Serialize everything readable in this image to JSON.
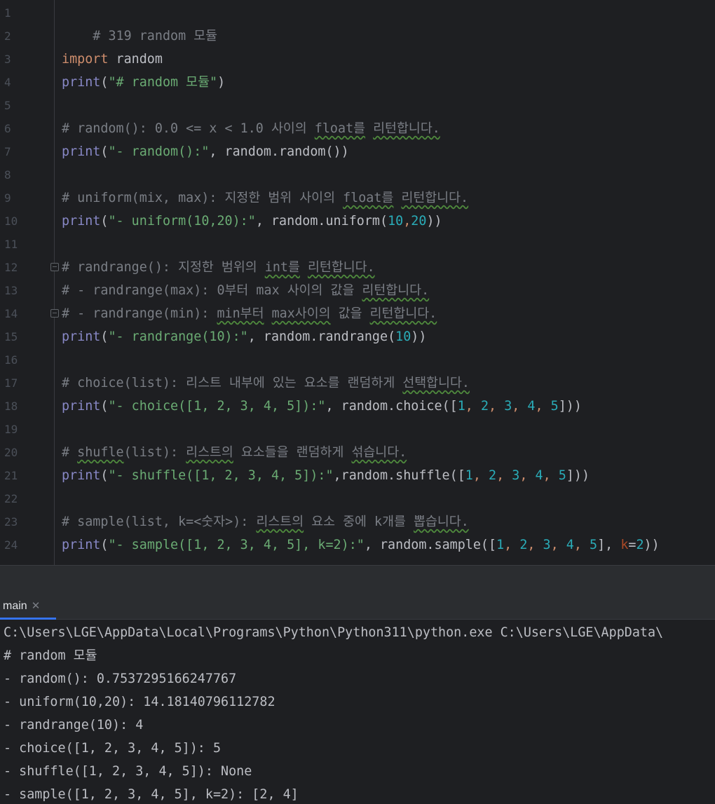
{
  "editor": {
    "line_numbers": [
      "1",
      "2",
      "3",
      "4",
      "5",
      "6",
      "7",
      "8",
      "9",
      "10",
      "11",
      "12",
      "13",
      "14",
      "15",
      "16",
      "17",
      "18",
      "19",
      "20",
      "21",
      "22",
      "23",
      "24"
    ],
    "code": {
      "l1": "# 319 random 모듈",
      "l3_kw": "import",
      "l3_rest": " random",
      "l4_print": "print",
      "l4_open": "(",
      "l4_str": "\"# random 모듈\"",
      "l4_close": ")",
      "l6": "# random(): 0.0 <= x < 1.0 사이의 ",
      "l6_w1": "float를",
      "l6_sp": " ",
      "l6_w2": "리턴합니다.",
      "l7_print": "print",
      "l7_open": "(",
      "l7_str": "\"- random():\"",
      "l7_rest": ", random.random())",
      "l9": "# uniform(mix, max): 지정한 범위 사이의 ",
      "l9_w1": "float를",
      "l9_sp": " ",
      "l9_w2": "리턴합니다.",
      "l10_print": "print",
      "l10_open": "(",
      "l10_str": "\"- uniform(10,20):\"",
      "l10_a": ", random.uniform(",
      "l10_n1": "10",
      "l10_c": ",",
      "l10_n2": "20",
      "l10_z": "))",
      "l12": "# randrange(): 지정한 범위의 ",
      "l12_w1": "int를",
      "l12_sp": " ",
      "l12_w2": "리턴합니다.",
      "l13": "# - randrange(max): 0부터 max 사이의 값을 ",
      "l13_w1": "리턴합니다.",
      "l14": "# - randrange(min): ",
      "l14_w1": "min부터",
      "l14_sp": " ",
      "l14_w2": "max사이의",
      "l14_mid": " 값을 ",
      "l14_w3": "리턴합니다.",
      "l15_print": "print",
      "l15_open": "(",
      "l15_str": "\"- randrange(10):\"",
      "l15_a": ", random.randrange(",
      "l15_n": "10",
      "l15_z": "))",
      "l17": "# choice(list): 리스트 내부에 있는 요소를 랜덤하게 ",
      "l17_w1": "선택합니다.",
      "l18_print": "print",
      "l18_open": "(",
      "l18_str": "\"- choice([1, 2, 3, 4, 5]):\"",
      "l18_a": ", random.choice([",
      "l18_n1": "1",
      "l18_n2": "2",
      "l18_n3": "3",
      "l18_n4": "4",
      "l18_n5": "5",
      "l18_z": "]))",
      "l20_a": "# ",
      "l20_w1": "shufle",
      "l20_b": "(list): ",
      "l20_w2": "리스트의",
      "l20_c": " 요소들을 랜덤하게 ",
      "l20_w3": "섞습니다.",
      "l21_print": "print",
      "l21_open": "(",
      "l21_str": "\"- shuffle([1, 2, 3, 4, 5]):\"",
      "l21_a": ",random.shuffle([",
      "l21_z": "]))",
      "l23_a": "# sample(list, k=<숫자>): ",
      "l23_w1": "리스트의",
      "l23_b": " 요소 중에 k개를 ",
      "l23_w2": "뽑습니다.",
      "l24_print": "print",
      "l24_open": "(",
      "l24_str": "\"- sample([1, 2, 3, 4, 5], k=2):\"",
      "l24_a": ", random.sample([",
      "l24_b": "], ",
      "l24_k": "k",
      "l24_eq": "=",
      "l24_n": "2",
      "l24_z": "))",
      "comma_sp": ", "
    }
  },
  "run_panel": {
    "tab_label": "main",
    "close_glyph": "✕",
    "output": [
      "C:\\Users\\LGE\\AppData\\Local\\Programs\\Python\\Python311\\python.exe C:\\Users\\LGE\\AppData\\",
      "# random 모듈",
      "- random(): 0.7537295166247767",
      "- uniform(10,20): 14.18140796112782",
      "- randrange(10): 4",
      "- choice([1, 2, 3, 4, 5]): 5",
      "- shuffle([1, 2, 3, 4, 5]): None",
      "- sample([1, 2, 3, 4, 5], k=2): [2, 4]"
    ]
  },
  "colors": {
    "background": "#1e1f22",
    "keyword": "#cf8e6d",
    "string": "#6aab73",
    "number": "#2aacb8",
    "comment": "#7a7e85",
    "builtin": "#8888c6",
    "tab_accent": "#3574f0"
  },
  "icons": {
    "fold_markers": "fold-icon",
    "tab_close": "close-icon"
  }
}
